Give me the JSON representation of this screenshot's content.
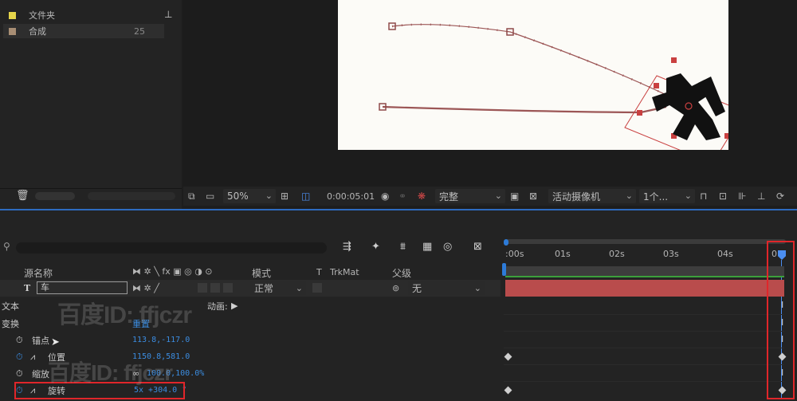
{
  "project": {
    "items": [
      {
        "label": "文件夹",
        "color": "#e5d54a",
        "count": ""
      },
      {
        "label": "合成",
        "color": "#a88e74",
        "count": "25"
      }
    ]
  },
  "viewer": {
    "zoom": "50%",
    "timecode": "0:00:05:01",
    "resolution": "完整",
    "camera": "活动摄像机",
    "views": "1个..."
  },
  "timeline": {
    "ticks": [
      ":00s",
      "01s",
      "02s",
      "03s",
      "04s",
      "0"
    ],
    "headers": {
      "source_name": "源名称",
      "mode": "模式",
      "t": "T",
      "trkmat": "TrkMat",
      "parent": "父级"
    },
    "layer": {
      "type": "T",
      "name": "车",
      "mode": "正常",
      "parent": "无"
    },
    "rows": {
      "text": "文本",
      "animate": "动画:",
      "transform": "变换",
      "reset": "重置",
      "anchor": {
        "label": "锚点",
        "value": "113.8,-117.0"
      },
      "position": {
        "label": "位置",
        "value": "1150.8,581.0"
      },
      "scale": {
        "label": "缩放",
        "value": "100.0,100.0%"
      },
      "rotation": {
        "label": "旋转",
        "value": "5x +304.0 °"
      }
    }
  },
  "watermark": "百度ID: ffjczr",
  "colors": {
    "accent": "#2d6bc0",
    "value": "#3b8ce0",
    "highlight": "#e0262a",
    "layer_bar": "#b94c4c"
  }
}
